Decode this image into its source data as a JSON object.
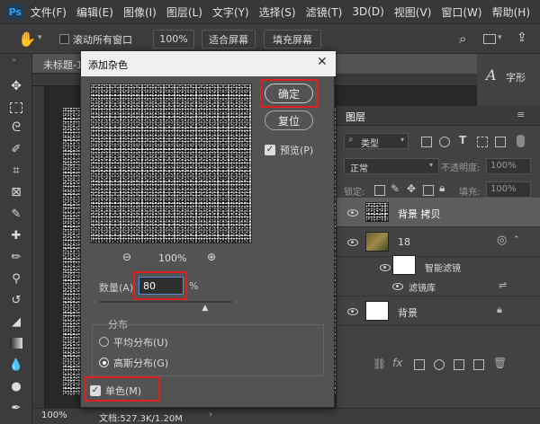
{
  "app": {
    "logo": "Ps"
  },
  "menubar": {
    "items": [
      "文件(F)",
      "编辑(E)",
      "图像(I)",
      "图层(L)",
      "文字(Y)",
      "选择(S)",
      "滤镜(T)",
      "3D(D)",
      "视图(V)",
      "窗口(W)",
      "帮助(H)"
    ]
  },
  "options_bar": {
    "scroll_all_label": "滚动所有窗口",
    "zoom_value": "100%",
    "fit_screen_label": "适合屏幕",
    "fill_screen_label": "填充屏幕"
  },
  "document": {
    "tab_title": "未标题-1"
  },
  "status_bar": {
    "zoom": "100%",
    "doc_info": "文档:527.3K/1.20M"
  },
  "right_panel": {
    "character_label": "字形"
  },
  "dialog": {
    "title": "添加杂色",
    "ok_label": "确定",
    "reset_label": "复位",
    "preview_label": "预览(P)",
    "preview_checked": true,
    "zoom_value": "100%",
    "amount_label": "数量(A)",
    "amount_value": "80",
    "amount_unit": "%",
    "amount_slider_fraction": 0.8,
    "distribution_label": "分布",
    "uniform_label": "平均分布(U)",
    "gaussian_label": "高斯分布(G)",
    "selected_distribution": "gaussian",
    "monochrome_label": "单色(M)",
    "monochrome_checked": true
  },
  "layers_panel": {
    "tab_label": "图层",
    "kind_label": "类型",
    "blend_mode": "正常",
    "opacity_label": "不透明度:",
    "opacity_value": "100%",
    "lock_label": "锁定:",
    "fill_label": "填充:",
    "fill_value": "100%",
    "layers": [
      {
        "name": "背景 拷贝",
        "selected": true
      },
      {
        "name": "18",
        "selected": false
      },
      {
        "name": "智能滤镜",
        "selected": false
      },
      {
        "name": "滤镜库",
        "selected": false
      },
      {
        "name": "背景",
        "selected": false
      }
    ]
  },
  "colors": {
    "highlight": "#e02020",
    "dialog_bg": "#535353",
    "panel_bg": "#424242"
  }
}
